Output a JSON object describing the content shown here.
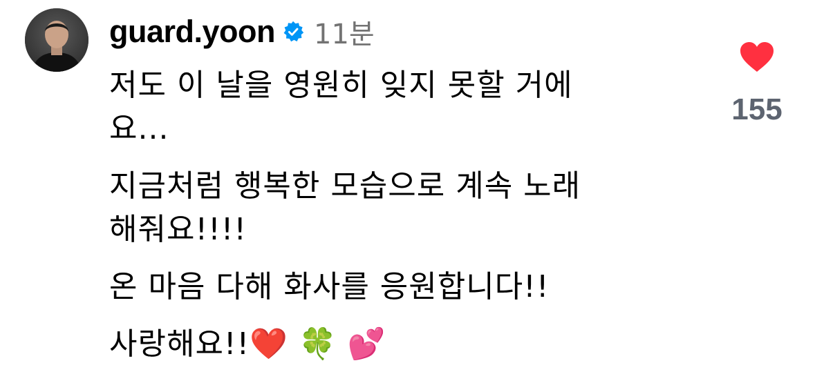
{
  "comment": {
    "username": "guard.yoon",
    "verified_icon": "verified-badge-icon",
    "timestamp": "11분",
    "lines": [
      "저도 이 날을 영원히 잊지 못할 거에",
      "요...",
      "지금처럼 행복한 모습으로 계속 노래",
      "해줘요!!!!",
      "온 마음 다해 화사를 응원합니다!!",
      "사랑해요!!❤️ 🍀 💕"
    ],
    "like_icon": "heart-icon",
    "like_count": "155",
    "colors": {
      "verified_blue": "#0095f6",
      "like_red": "#ff3040",
      "meta_gray": "#737373",
      "count_gray": "#5d6470"
    }
  }
}
